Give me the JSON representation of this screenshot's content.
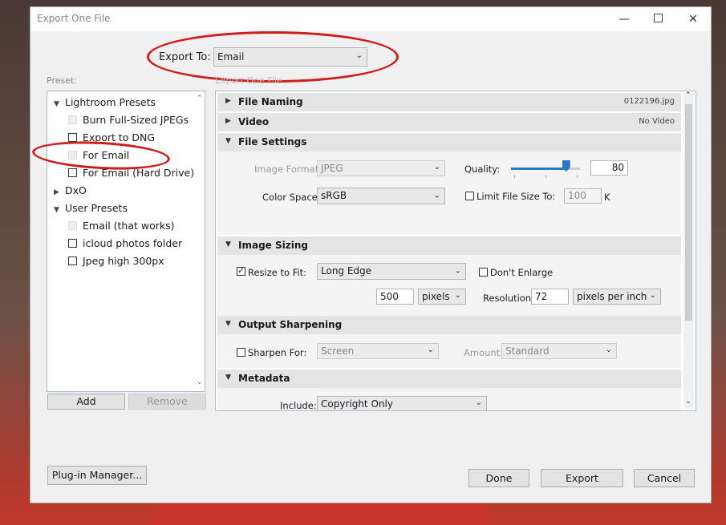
{
  "dialog": {
    "title": "Export One File"
  },
  "export_to": {
    "label": "Export To:",
    "value": "Email"
  },
  "preset": {
    "label": "Preset:",
    "groups": [
      {
        "name": "Lightroom Presets",
        "expanded": true,
        "items": [
          "Burn Full-Sized JPEGs",
          "Export to DNG",
          "For Email",
          "For Email (Hard Drive)"
        ]
      },
      {
        "name": "DxO",
        "expanded": false,
        "items": []
      },
      {
        "name": "User Presets",
        "expanded": true,
        "items": [
          "Email (that works)",
          "icloud photos folder",
          "Jpeg high 300px"
        ]
      }
    ],
    "add_label": "Add",
    "remove_label": "Remove"
  },
  "section_header_faded": "Export One File",
  "sections": {
    "file_naming": {
      "title": "File Naming",
      "value": "0122196.jpg"
    },
    "video": {
      "title": "Video",
      "value": "No Video"
    },
    "file_settings": {
      "title": "File Settings",
      "image_format_label": "Image Format:",
      "image_format": "JPEG",
      "quality_label": "Quality:",
      "quality": "80",
      "quality_fraction": 0.8,
      "color_space_label": "Color Space:",
      "color_space": "sRGB",
      "limit_label": "Limit File Size To:",
      "limit_value": "100",
      "limit_unit": "K"
    },
    "image_sizing": {
      "title": "Image Sizing",
      "resize_label": "Resize to Fit:",
      "resize_mode": "Long Edge",
      "dont_enlarge_label": "Don't Enlarge",
      "size_value": "500",
      "size_unit": "pixels",
      "resolution_label": "Resolution:",
      "resolution": "72",
      "resolution_unit": "pixels per inch"
    },
    "output_sharpening": {
      "title": "Output Sharpening",
      "sharpen_label": "Sharpen For:",
      "sharpen_for": "Screen",
      "amount_label": "Amount:",
      "amount": "Standard"
    },
    "metadata": {
      "title": "Metadata",
      "include_label": "Include:",
      "include": "Copyright Only"
    }
  },
  "buttons": {
    "plugin_manager": "Plug-in Manager...",
    "done": "Done",
    "export": "Export",
    "cancel": "Cancel"
  },
  "colors": {
    "annotation": "#d21c1c",
    "accent": "#2979c9"
  }
}
